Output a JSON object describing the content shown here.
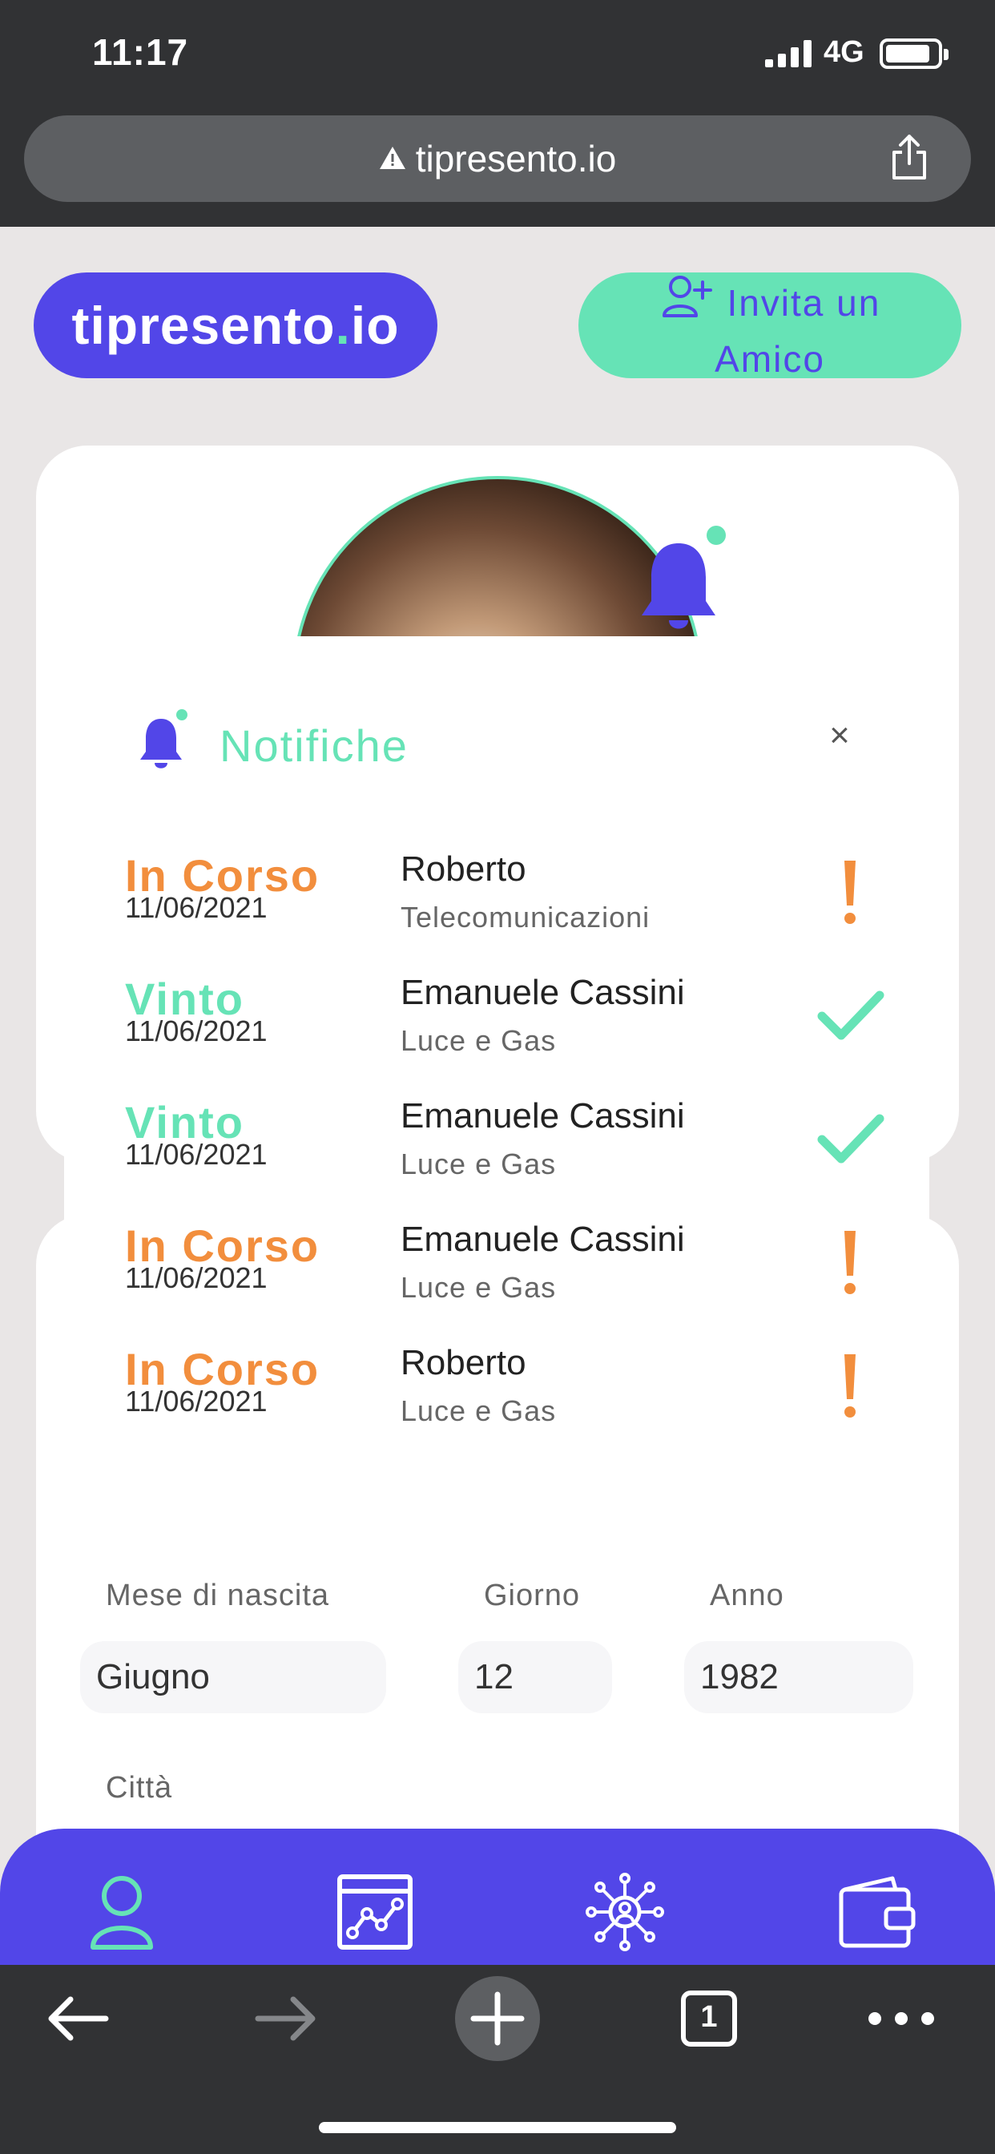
{
  "status_bar": {
    "time": "11:17",
    "network": "4G"
  },
  "browser": {
    "url": "tipresento.io"
  },
  "header": {
    "logo_main": "tipresento",
    "logo_dot": ".",
    "logo_suffix": "io",
    "invite_line1": "Invita un",
    "invite_line2": "Amico"
  },
  "notifications": {
    "title": "Notifiche",
    "close_label": "×",
    "items": [
      {
        "status": "In Corso",
        "date": "11/06/2021",
        "name": "Roberto",
        "category": "Telecomunicazioni",
        "icon": "exclamation-icon"
      },
      {
        "status": "Vinto",
        "date": "11/06/2021",
        "name": "Emanuele Cassini",
        "category": "Luce e Gas",
        "icon": "check-icon"
      },
      {
        "status": "Vinto",
        "date": "11/06/2021",
        "name": "Emanuele Cassini",
        "category": "Luce e Gas",
        "icon": "check-icon"
      },
      {
        "status": "In Corso",
        "date": "11/06/2021",
        "name": "Emanuele Cassini",
        "category": "Luce e Gas",
        "icon": "exclamation-icon"
      },
      {
        "status": "In Corso",
        "date": "11/06/2021",
        "name": "Roberto",
        "category": "Luce e Gas",
        "icon": "exclamation-icon"
      }
    ]
  },
  "form": {
    "month_label": "Mese di nascita",
    "month_value": "Giugno",
    "day_label": "Giorno",
    "day_value": "12",
    "year_label": "Anno",
    "year_value": "1982",
    "city_label": "Città"
  },
  "bottom_nav": [
    "profile-icon",
    "chart-icon",
    "network-icon",
    "wallet-icon"
  ],
  "safari_toolbar": {
    "tabs_count": "1"
  },
  "colors": {
    "primary": "#5246e8",
    "accent": "#66e3b6",
    "orange": "#f28e3d"
  }
}
